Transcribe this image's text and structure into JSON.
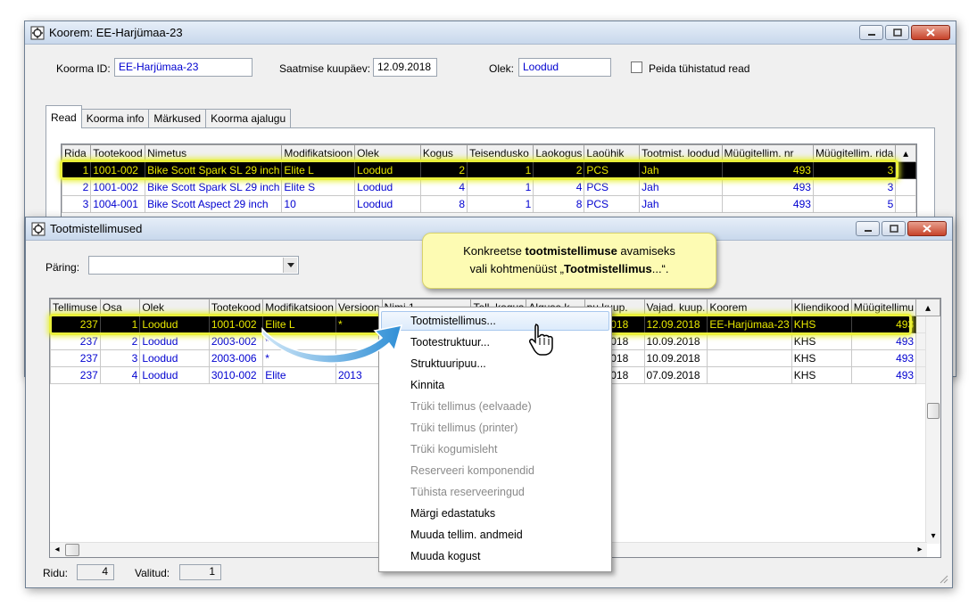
{
  "koorem_window": {
    "title": "Koorem: EE-Harjümaa-23",
    "koorma_id_label": "Koorma ID:",
    "koorma_id_value": "EE-Harjümaa-23",
    "saatmise_label": "Saatmise kuupäev:",
    "saatmise_value": "12.09.2018",
    "olek_label": "Olek:",
    "olek_value": "Loodud",
    "peida_label": "Peida tühistatud read",
    "tabs": [
      "Read",
      "Koorma info",
      "Märkused",
      "Koorma ajalugu"
    ],
    "columns": [
      "Rida",
      "Tootekood",
      "Nimetus",
      "Modifikatsioon",
      "Olek",
      "Kogus",
      "Teisendusko",
      "Laokogus",
      "Laoühik",
      "Tootmist. loodud",
      "Müügitellim. nr",
      "Müügitellim. rida"
    ],
    "rows": [
      [
        "1",
        "1001-002",
        "Bike Scott Spark SL 29 inch",
        "Elite L",
        "Loodud",
        "2",
        "1",
        "2",
        "PCS",
        "Jah",
        "493",
        "3"
      ],
      [
        "2",
        "1001-002",
        "Bike Scott Spark SL 29 inch",
        "Elite S",
        "Loodud",
        "4",
        "1",
        "4",
        "PCS",
        "Jah",
        "493",
        "3"
      ],
      [
        "3",
        "1004-001",
        "Bike Scott Aspect 29 inch",
        "10",
        "Loodud",
        "8",
        "1",
        "8",
        "PCS",
        "Jah",
        "493",
        "5"
      ]
    ]
  },
  "tootmis_window": {
    "title": "Tootmistellimused",
    "paring_label": "Päring:",
    "paring_value": "",
    "columns": [
      "Tellimuse",
      "Osa",
      "Olek",
      "Tootekood",
      "Modifikatsioon",
      "Versioon",
      "Nimi 1",
      "Tell. kogus",
      "Alguse k",
      "pu kuup.",
      "Vajad. kuup.",
      "Koorem",
      "Kliendikood",
      "Müügitellimu"
    ],
    "rows": [
      [
        "237",
        "1",
        "Loodud",
        "1001-002",
        "Elite L",
        "*",
        "",
        "",
        "",
        ".09.2018",
        "12.09.2018",
        "EE-Harjümaa-23",
        "KHS",
        "493"
      ],
      [
        "237",
        "2",
        "Loodud",
        "2003-002",
        "*",
        "",
        "",
        "",
        "",
        ".09.2018",
        "10.09.2018",
        "",
        "KHS",
        "493"
      ],
      [
        "237",
        "3",
        "Loodud",
        "2003-006",
        "*",
        "",
        "",
        "",
        "",
        ".09.2018",
        "10.09.2018",
        "",
        "KHS",
        "493"
      ],
      [
        "237",
        "4",
        "Loodud",
        "3010-002",
        "Elite",
        "2013",
        "",
        "",
        "",
        ".09.2018",
        "07.09.2018",
        "",
        "KHS",
        "493"
      ]
    ],
    "ridu_label": "Ridu:",
    "ridu_value": "4",
    "valitud_label": "Valitud:",
    "valitud_value": "1"
  },
  "context_menu": [
    {
      "label": "Tootmistellimus...",
      "enabled": true,
      "hover": true
    },
    {
      "label": "Tootestruktuur...",
      "enabled": true
    },
    {
      "label": "Struktuuripuu...",
      "enabled": true
    },
    {
      "label": "Kinnita",
      "enabled": true
    },
    {
      "label": "Trüki tellimus (eelvaade)",
      "enabled": false
    },
    {
      "label": "Trüki tellimus (printer)",
      "enabled": false
    },
    {
      "label": "Trüki kogumisleht",
      "enabled": false
    },
    {
      "label": "Reserveeri komponendid",
      "enabled": false
    },
    {
      "label": "Tühista reserveeringud",
      "enabled": false
    },
    {
      "label": "Märgi edastatuks",
      "enabled": true
    },
    {
      "label": "Muuda tellim. andmeid",
      "enabled": true
    },
    {
      "label": "Muuda kogust",
      "enabled": true
    }
  ],
  "callout": {
    "line1_pre": "Konkreetse ",
    "line1_bold": "tootmistellimuse",
    "line1_post": " avamiseks",
    "line2_pre": "vali kohtmenüüst „",
    "line2_bold": "Tootmistellimus",
    "line2_post": "...“."
  },
  "colors": {
    "selected_bg": "#000000",
    "selected_fg": "#e8e800",
    "link_blue": "#0000d0",
    "highlight": "#e9ef3b",
    "callout_bg": "#fdfbb3",
    "arrow": "#4aa3e0"
  }
}
